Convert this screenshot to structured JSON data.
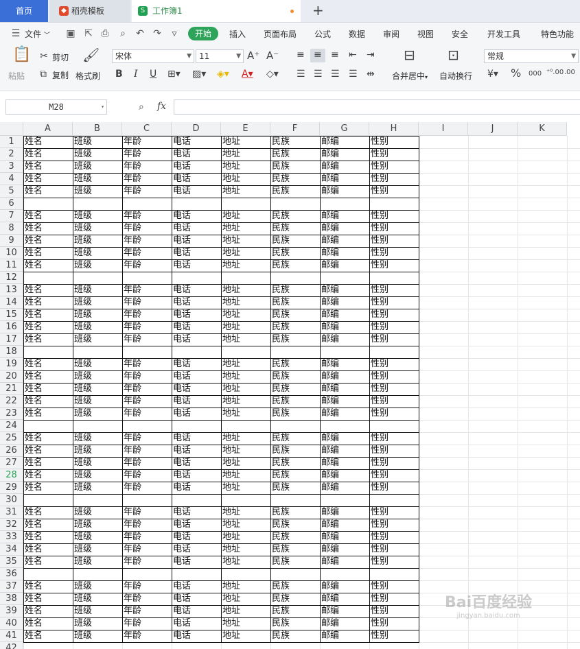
{
  "tabs": {
    "home": "首页",
    "template": "稻壳模板",
    "workbook": "工作簿1"
  },
  "menu": {
    "file": "文件",
    "start": "开始",
    "items": [
      "插入",
      "页面布局",
      "公式",
      "数据",
      "审阅",
      "视图",
      "安全",
      "开发工具",
      "特色功能"
    ]
  },
  "ribbon": {
    "paste": "粘贴",
    "cut": "剪切",
    "copy": "复制",
    "format_painter": "格式刷",
    "font_name": "宋体",
    "font_size": "11",
    "merge": "合并居中",
    "wrap": "自动换行",
    "number_format": "常规"
  },
  "formula_bar": {
    "name_box": "M28",
    "fx": "fx",
    "content": ""
  },
  "columns": [
    "A",
    "B",
    "C",
    "D",
    "E",
    "F",
    "G",
    "H",
    "I",
    "J",
    "K"
  ],
  "active_row": 28,
  "table": {
    "headers": [
      "姓名",
      "班级",
      "年龄",
      "电话",
      "地址",
      "民族",
      "邮编",
      "性别"
    ],
    "row_count": 41,
    "blank_rows": [
      6,
      12,
      18,
      24,
      30,
      36
    ]
  },
  "watermark": {
    "brand": "Bai百度经验",
    "url": "jingyan.baidu.com"
  }
}
